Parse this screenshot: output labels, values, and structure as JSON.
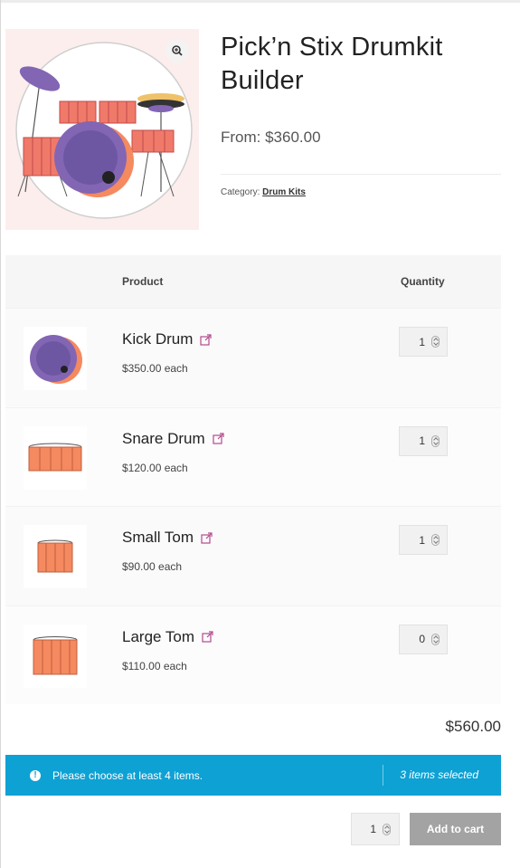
{
  "product": {
    "title": "Pick’n Stix Drumkit Builder",
    "price_from": "From: $360.00",
    "category_label": "Category:",
    "category_value": "Drum Kits"
  },
  "table": {
    "col_product": "Product",
    "col_quantity": "Quantity",
    "rows": [
      {
        "name": "Kick Drum",
        "price": "$350.00 each",
        "qty": "1",
        "icon": "kick-drum-icon"
      },
      {
        "name": "Snare Drum",
        "price": "$120.00 each",
        "qty": "1",
        "icon": "snare-drum-icon"
      },
      {
        "name": "Small Tom",
        "price": "$90.00 each",
        "qty": "1",
        "icon": "small-tom-icon"
      },
      {
        "name": "Large Tom",
        "price": "$110.00 each",
        "qty": "0",
        "icon": "large-tom-icon"
      }
    ]
  },
  "total": "$560.00",
  "notice": {
    "message": "Please choose at least 4 items.",
    "count": "3 items selected"
  },
  "cart": {
    "qty": "1",
    "button_label": "Add to cart"
  },
  "colors": {
    "notice_bg": "#0ea1d4",
    "accent_pink": "#b44a8e",
    "drum_orange": "#f5895f",
    "drum_purple": "#8266b4"
  }
}
